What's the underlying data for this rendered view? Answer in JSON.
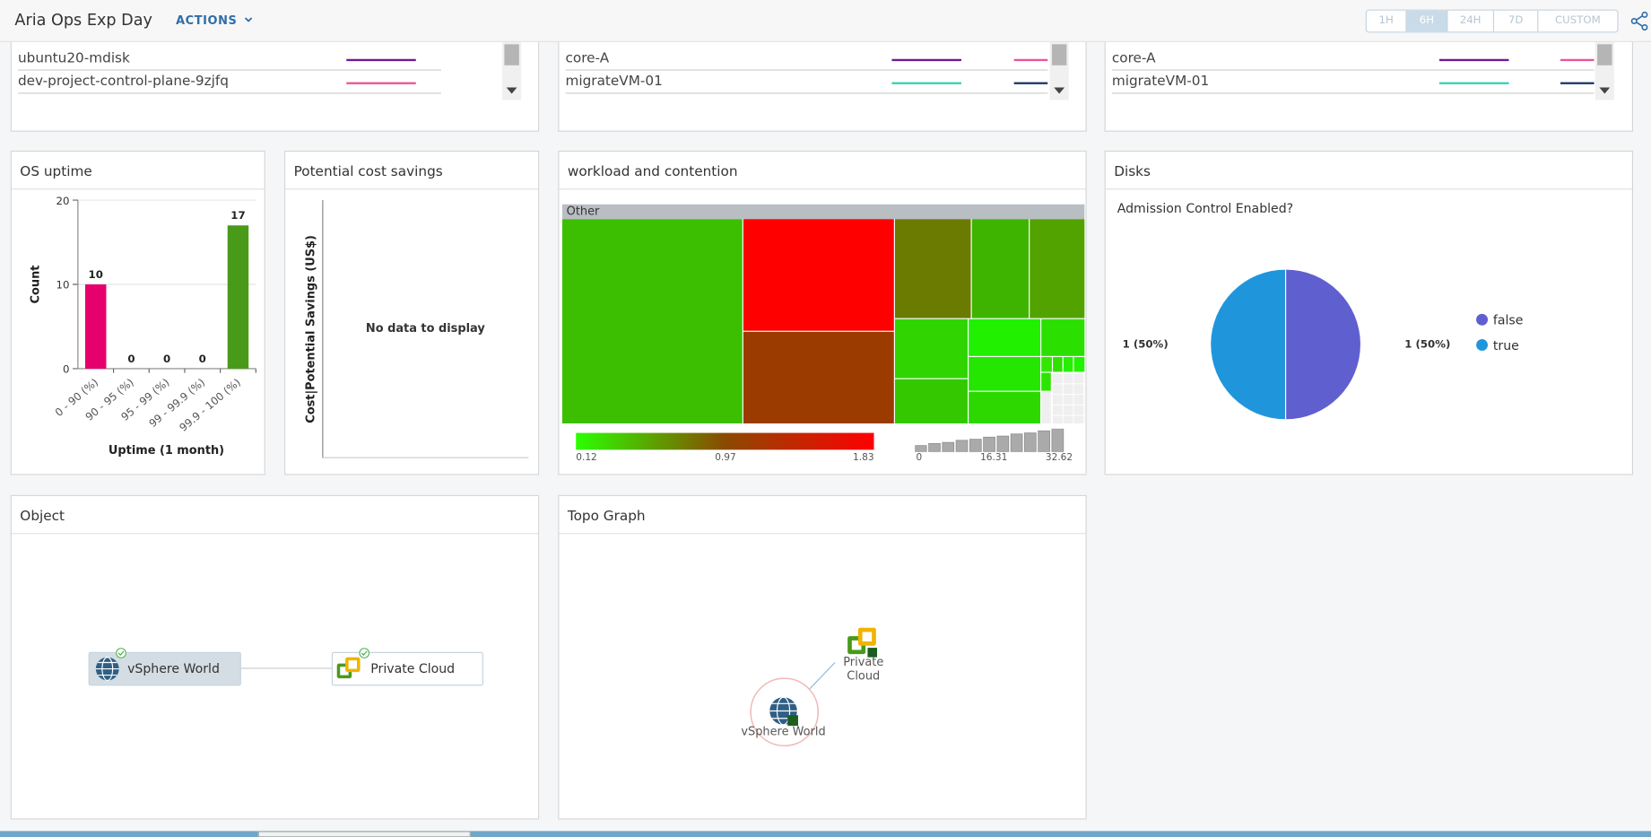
{
  "header": {
    "title": "Aria Ops Exp Day",
    "actions_label": "ACTIONS",
    "time_ranges": [
      "1H",
      "6H",
      "24H",
      "7D",
      "CUSTOM"
    ],
    "selected_range": "6H"
  },
  "top_panels": [
    {
      "rows": [
        {
          "label": "ubuntu20-mdisk",
          "color": "#6a1b9a"
        },
        {
          "label": "dev-project-control-plane-9zjfq",
          "color": "#e8579b"
        }
      ]
    },
    {
      "rows": [
        {
          "label": "core-A",
          "color": "#6a1b9a",
          "color2": "#e8579b"
        },
        {
          "label": "migrateVM-01",
          "color": "#36d1b5",
          "color2": "#1f3a6b"
        }
      ]
    },
    {
      "rows": [
        {
          "label": "core-A",
          "color": "#6a1b9a",
          "color2": "#e8579b"
        },
        {
          "label": "migrateVM-01",
          "color": "#36d1b5",
          "color2": "#1f3a6b"
        }
      ]
    }
  ],
  "os_uptime": {
    "title": "OS uptime",
    "chart_data": {
      "type": "bar",
      "categories": [
        "0 - 90 (%)",
        "90 - 95 (%)",
        "95 - 99 (%)",
        "99 - 99.9 (%)",
        "99.9 - 100 (%)"
      ],
      "values": [
        10,
        0,
        0,
        0,
        17
      ],
      "colors": [
        "#e6006e",
        "#e6006e",
        "#e6006e",
        "#e6006e",
        "#4a9a1a"
      ],
      "xlabel": "Uptime (1 month)",
      "ylabel": "Count",
      "ylim": [
        0,
        20
      ],
      "yticks": [
        "0",
        "10",
        "20"
      ]
    }
  },
  "cost_savings": {
    "title": "Potential cost savings",
    "ylabel": "Cost|Potential Savings (US$)",
    "empty_text": "No data to display"
  },
  "workload": {
    "title": "workload and contention",
    "group_label": "Other",
    "color_scale": {
      "min": "0.12",
      "mid": "0.97",
      "max": "1.83"
    },
    "size_scale": {
      "min": "0",
      "mid": "16.31",
      "max": "32.62"
    },
    "colors": [
      "#3cbf00",
      "#ff0000",
      "#9b3b00",
      "#6b7a00",
      "#3eb400",
      "#52a300",
      "#30d400",
      "#2be000",
      "#21f000",
      "#33e600"
    ]
  },
  "disks": {
    "title": "Disks",
    "chart_data": {
      "type": "pie",
      "title": "Admission Control Enabled?",
      "slices": [
        {
          "label": "false",
          "value": 1,
          "display": "1 (50%)",
          "color": "#5f5fcf"
        },
        {
          "label": "true",
          "value": 1,
          "display": "1 (50%)",
          "color": "#1f96dc"
        }
      ]
    }
  },
  "object_panel": {
    "title": "Object",
    "nodes": [
      {
        "label": "vSphere World"
      },
      {
        "label": "Private Cloud"
      }
    ]
  },
  "topo_panel": {
    "title": "Topo Graph",
    "nodes": [
      {
        "label": "Private Cloud"
      },
      {
        "label": "vSphere World"
      }
    ]
  }
}
